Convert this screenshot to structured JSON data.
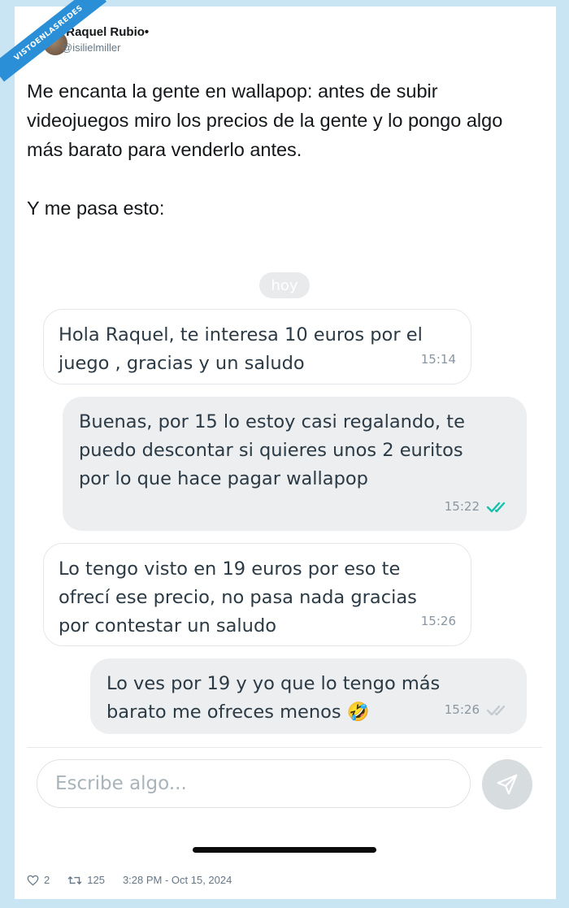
{
  "watermark": "VISTOENLASREDES",
  "author": {
    "name": "•Raquel Rubio•",
    "handle": "@isilielmiller"
  },
  "tweet": {
    "paragraph1": "Me encanta la gente en wallapop: antes de subir videojuegos miro los precios de la gente y lo pongo algo más barato para venderlo antes.",
    "paragraph2": "Y me pasa esto:"
  },
  "chat": {
    "date_label": "hoy",
    "messages": [
      {
        "direction": "in",
        "text": "Hola Raquel, te interesa 10 euros por el\njuego , gracias y un saludo",
        "time": "15:14"
      },
      {
        "direction": "out",
        "text": "Buenas, por 15 lo estoy casi regalando, te\npuedo descontar si quieres unos 2 euritos\npor lo que hace pagar wallapop",
        "time": "15:22",
        "status": "read"
      },
      {
        "direction": "in",
        "text": "Lo tengo visto en 19 euros por eso te\nofrecí ese precio, no pasa nada gracias\npor contestar un saludo",
        "time": "15:26"
      },
      {
        "direction": "out",
        "text": "Lo ves por 19 y yo que lo tengo más\nbarato me ofreces menos 🤣",
        "time": "15:26",
        "status": "delivered"
      }
    ],
    "composer_placeholder": "Escribe algo...",
    "colors": {
      "read_ticks": "#13c1ac",
      "delivered_ticks": "#c4cacf"
    }
  },
  "footer": {
    "likes": "2",
    "retweets": "125",
    "timestamp": "3:28 PM - Oct 15, 2024"
  }
}
